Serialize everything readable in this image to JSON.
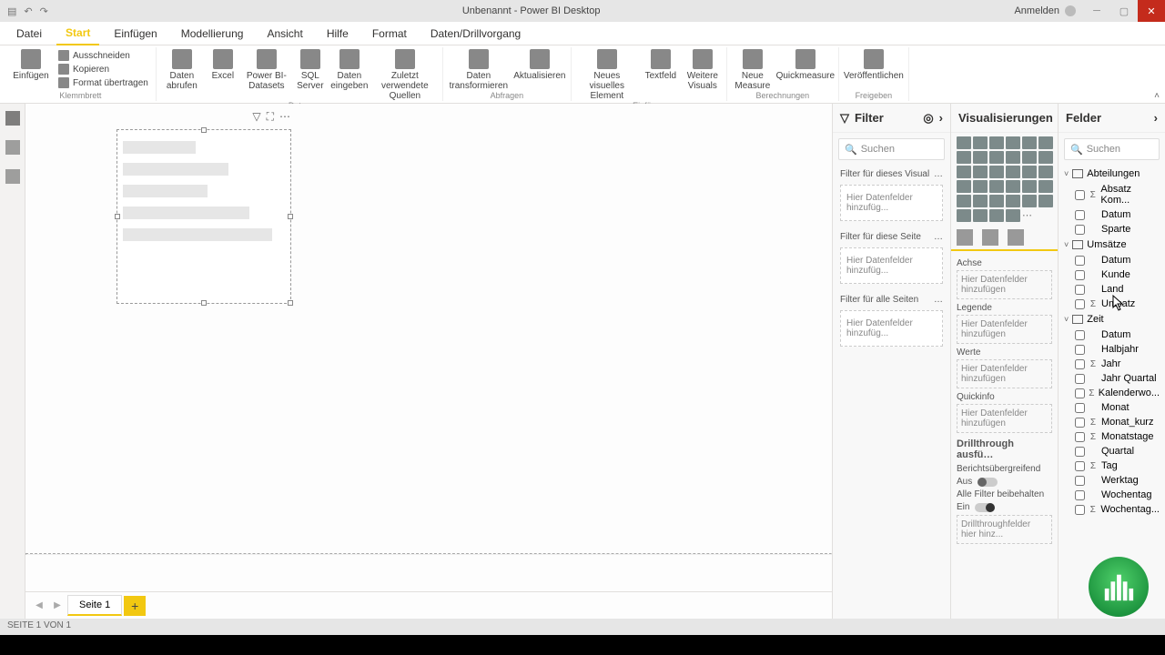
{
  "title": "Unbenannt - Power BI Desktop",
  "login": "Anmelden",
  "tabs": {
    "file": "Datei",
    "start": "Start",
    "einfuegen": "Einfügen",
    "modellierung": "Modellierung",
    "ansicht": "Ansicht",
    "hilfe": "Hilfe",
    "format": "Format",
    "drill": "Daten/Drillvorgang"
  },
  "ribbon": {
    "klemmbrett": {
      "label": "Klemmbrett",
      "ausschneiden": "Ausschneiden",
      "kopieren": "Kopieren",
      "format_uebertragen": "Format übertragen",
      "einfuegen": "Einfügen"
    },
    "daten": {
      "label": "Daten",
      "daten_abrufen": "Daten abrufen",
      "excel": "Excel",
      "pbi": "Power BI-Datasets",
      "sql": "SQL Server",
      "eingeben": "Daten eingeben",
      "zuletzt": "Zuletzt verwendete Quellen"
    },
    "abfragen": {
      "label": "Abfragen",
      "transformieren": "Daten transformieren",
      "aktualisieren": "Aktualisieren"
    },
    "einfuegen_g": {
      "label": "Einfügen",
      "neues_visual": "Neues visuelles Element",
      "textfeld": "Textfeld",
      "weitere": "Weitere Visuals"
    },
    "berechnungen": {
      "label": "Berechnungen",
      "neue_measure": "Neue Measure",
      "quickmeasure": "Quickmeasure"
    },
    "freigeben": {
      "label": "Freigeben",
      "veroeffentlichen": "Veröffentlichen"
    }
  },
  "filter": {
    "title": "Filter",
    "search": "Suchen",
    "visual": "Filter für dieses Visual",
    "page": "Filter für diese Seite",
    "all": "Filter für alle Seiten",
    "drop": "Hier Datenfelder hinzufüg..."
  },
  "viz": {
    "title": "Visualisierungen",
    "achse": "Achse",
    "legende": "Legende",
    "werte": "Werte",
    "quickinfo": "Quickinfo",
    "drop": "Hier Datenfelder hinzufügen",
    "drill_header": "Drillthrough ausfü…",
    "berichts": "Berichtsübergreifend",
    "aus": "Aus",
    "alle_filter": "Alle Filter beibehalten",
    "ein": "Ein",
    "drill_drop": "Drillthroughfelder hier hinz..."
  },
  "fields": {
    "title": "Felder",
    "search": "Suchen",
    "tables": {
      "abteilungen": {
        "name": "Abteilungen",
        "fields": [
          "Absatz Kom...",
          "Datum",
          "Sparte"
        ]
      },
      "umsaetze": {
        "name": "Umsätze",
        "fields": [
          "Datum",
          "Kunde",
          "Land",
          "Umsatz"
        ]
      },
      "zeit": {
        "name": "Zeit",
        "fields": [
          "Datum",
          "Halbjahr",
          "Jahr",
          "Jahr Quartal",
          "Kalenderwo...",
          "Monat",
          "Monat_kurz",
          "Monatstage",
          "Quartal",
          "Tag",
          "Werktag",
          "Wochentag",
          "Wochentag..."
        ]
      }
    },
    "sigma_fields": [
      "Absatz Kom...",
      "Umsatz",
      "Jahr",
      "Kalenderwo...",
      "Monat_kurz",
      "Monatstage",
      "Tag",
      "Wochentag..."
    ]
  },
  "page_tabs": {
    "page1": "Seite 1"
  },
  "status": "SEITE 1 VON 1"
}
